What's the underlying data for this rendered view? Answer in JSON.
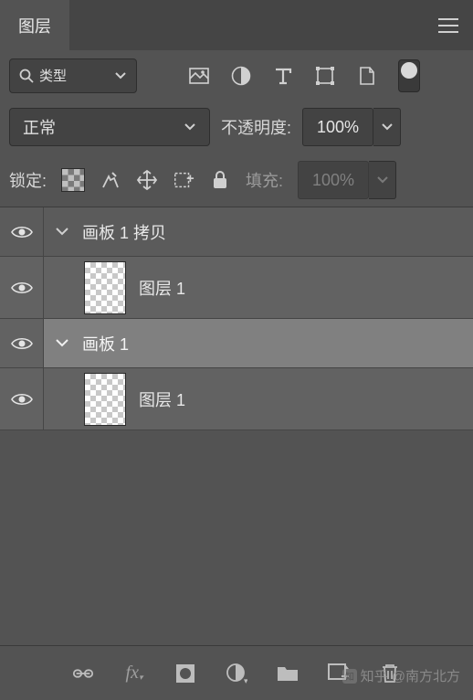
{
  "titlebar": {
    "tab": "图层"
  },
  "filterRow": {
    "filterLabel": "类型"
  },
  "blendRow": {
    "blendMode": "正常",
    "opacityLabel": "不透明度:",
    "opacityValue": "100%"
  },
  "lockRow": {
    "lockLabel": "锁定:",
    "fillLabel": "填充:",
    "fillValue": "100%"
  },
  "layers": [
    {
      "type": "group",
      "name": "画板 1 拷贝",
      "selected": false
    },
    {
      "type": "layer",
      "name": "图层 1"
    },
    {
      "type": "group",
      "name": "画板 1",
      "selected": true
    },
    {
      "type": "layer",
      "name": "图层 1"
    }
  ],
  "watermark": "知乎 @南方北方"
}
